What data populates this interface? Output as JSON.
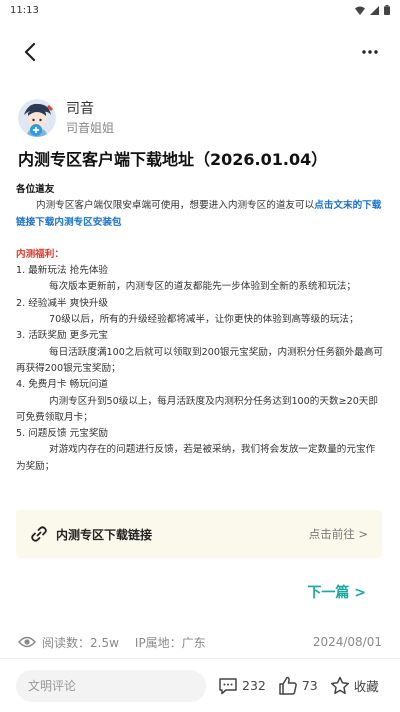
{
  "status_bar": {
    "time": "11:13"
  },
  "author": {
    "name": "司音",
    "subtitle": "司音姐姐"
  },
  "article": {
    "title": "内测专区客户端下载地址（2026.01.04）",
    "greeting": "各位道友",
    "intro_text": "内测专区客户端仅限安卓端可使用，想要进入内测专区的道友可以",
    "intro_link": "点击文末的下载链接下载内测专区安装包",
    "benefits_heading": "内测福利：",
    "items": [
      {
        "heading": "1. 最新玩法 抢先体验",
        "body": "每次版本更新前，内测专区的道友都能先一步体验到全新的系统和玩法；"
      },
      {
        "heading": "2. 经验减半 爽快升级",
        "body": "70级以后，所有的升级经验都将减半，让你更快的体验到高等级的玩法；"
      },
      {
        "heading": "3. 活跃奖励 更多元宝",
        "body": "每日活跃度满100之后就可以领取到200银元宝奖励，内测积分任务额外最高可再获得200银元宝奖励；"
      },
      {
        "heading": "4. 免费月卡 畅玩问道",
        "body": "内测专区升到50级以上，每月活跃度及内测积分任务达到100的天数≥20天即可免费领取月卡；"
      },
      {
        "heading": "5. 问题反馈 元宝奖励",
        "body": "对游戏内存在的问题进行反馈，若是被采纳，我们将会发放一定数量的元宝作为奖励；"
      }
    ]
  },
  "download_card": {
    "label": "内测专区下载链接",
    "go": "点击前往 >"
  },
  "next": {
    "label": "下一篇 >"
  },
  "meta": {
    "reads": "阅读数：2.5w",
    "ip": "IP属地：广东",
    "date": "2024/08/01"
  },
  "bottom": {
    "comment_placeholder": "文明评论",
    "comments": "232",
    "likes": "73",
    "favorite": "收藏"
  }
}
